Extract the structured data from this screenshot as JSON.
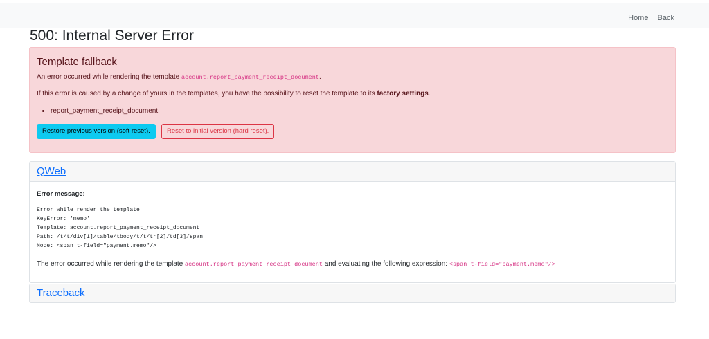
{
  "topnav": {
    "home": "Home",
    "back": "Back"
  },
  "page_title": "500: Internal Server Error",
  "alert": {
    "title": "Template fallback",
    "line1_prefix": "An error occurred while rendering the template",
    "line1_code": "account.report_payment_receipt_document",
    "line1_suffix": ".",
    "line2_prefix": "If this error is caused by a change of yours in the templates, you have the possibility to reset the template to its",
    "line2_strong": "factory settings",
    "line2_suffix": ".",
    "list_items": [
      "report_payment_receipt_document"
    ],
    "soft_reset_label": "Restore previous version (soft reset).",
    "hard_reset_label": "Reset to initial version (hard reset)."
  },
  "qweb": {
    "header": "QWeb",
    "error_label": "Error message:",
    "error_lines": [
      "Error while render the template",
      "KeyError: 'memo'",
      "Template: account.report_payment_receipt_document",
      "Path: /t/t/div[1]/table/tbody/t/t/tr[2]/td[3]/span",
      "Node: <span t-field=\"payment.memo\"/>"
    ],
    "summary_prefix": "The error occurred while rendering the template",
    "summary_template": "account.report_payment_receipt_document",
    "summary_middle": "and evaluating the following expression:",
    "summary_expression": "<span t-field=\"payment.memo\"/>"
  },
  "traceback": {
    "header": "Traceback"
  }
}
